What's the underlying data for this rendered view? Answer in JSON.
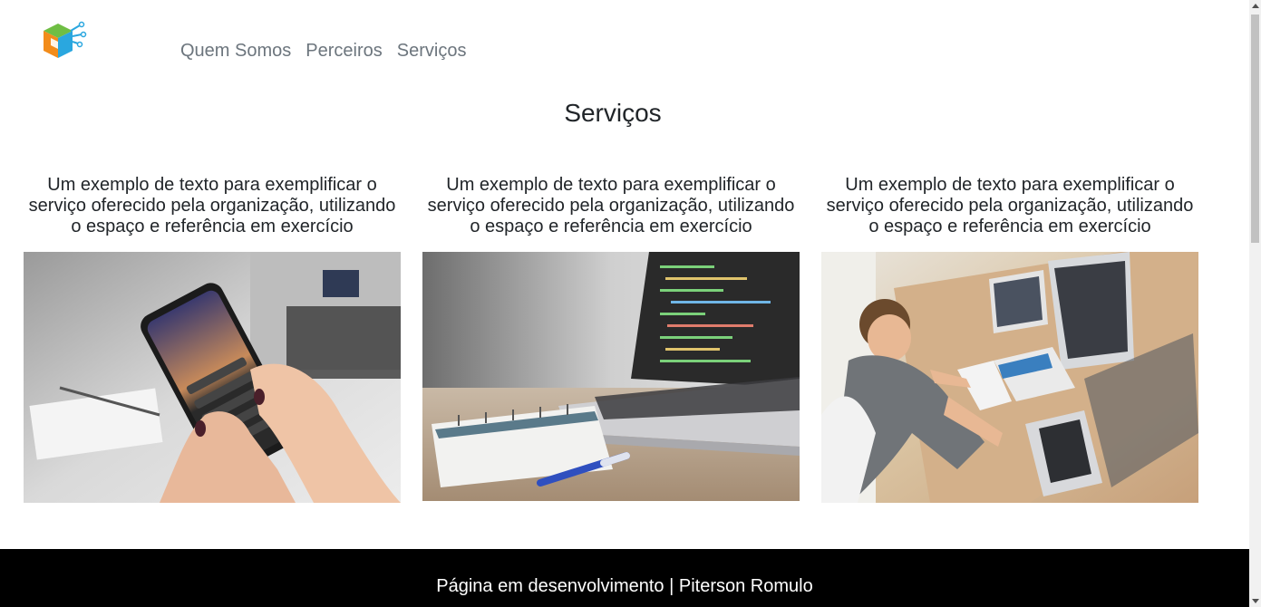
{
  "header": {
    "logo_icon": "cube-circuit-logo-icon",
    "nav": [
      {
        "label": "Quem Somos"
      },
      {
        "label": "Perceiros"
      },
      {
        "label": "Serviços"
      }
    ]
  },
  "main": {
    "title": "Serviços",
    "cards": [
      {
        "text": "Um exemplo de texto para exemplificar o serviço oferecido pela organização, utilizando o espaço e referência em exercício",
        "image": "smartphone-photo"
      },
      {
        "text": "Um exemplo de texto para exemplificar o serviço oferecido pela organização, utilizando o espaço e referência em exercício",
        "image": "laptop-code-photo"
      },
      {
        "text": "Um exemplo de texto para exemplificar o serviço oferecido pela organização, utilizando o espaço e referência em exercício",
        "image": "man-at-desk-photo"
      }
    ]
  },
  "footer": {
    "text": "Página em desenvolvimento | Piterson Romulo"
  },
  "colors": {
    "nav_text": "#6c757d",
    "footer_bg": "#000000",
    "footer_text": "#ffffff",
    "logo_orange": "#f28c1b",
    "logo_green": "#6fbe44",
    "logo_blue": "#2aa7df"
  }
}
